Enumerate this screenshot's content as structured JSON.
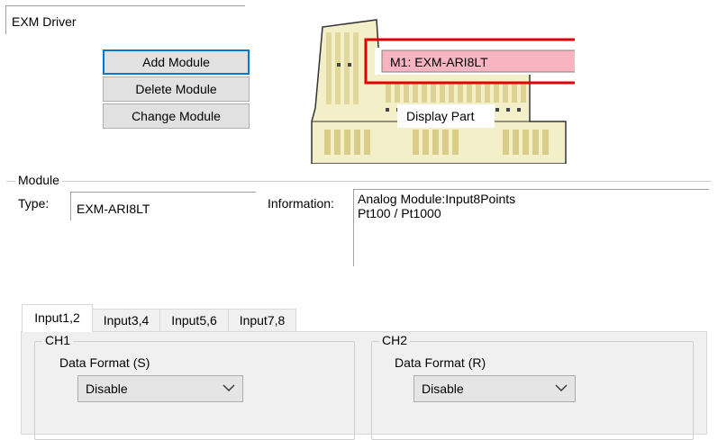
{
  "driver": {
    "name": "EXM Driver"
  },
  "buttons": {
    "add_module": "Add Module",
    "delete_module": "Delete Module",
    "change_module": "Change Module"
  },
  "module_image": {
    "slot_label": "M1: EXM-ARI8LT",
    "display_part_label": "Display Part"
  },
  "module": {
    "group_title": "Module",
    "type_label": "Type:",
    "type_value": "EXM-ARI8LT",
    "info_label": "Information:",
    "info_line1": "Analog Module:Input8Points",
    "info_line2": "Pt100 / Pt1000"
  },
  "tabs": [
    {
      "label": "Input1,2",
      "active": true
    },
    {
      "label": "Input3,4",
      "active": false
    },
    {
      "label": "Input5,6",
      "active": false
    },
    {
      "label": "Input7,8",
      "active": false
    }
  ],
  "channels": {
    "ch1": {
      "title": "CH1",
      "format_label": "Data Format (S)",
      "value": "Disable"
    },
    "ch2": {
      "title": "CH2",
      "format_label": "Data Format (R)",
      "value": "Disable"
    }
  },
  "colors": {
    "highlight_box": "#e00000",
    "slot_fill": "#f8b4c0",
    "module_body": "#f3efc9",
    "module_stripe": "#e3dba3"
  }
}
